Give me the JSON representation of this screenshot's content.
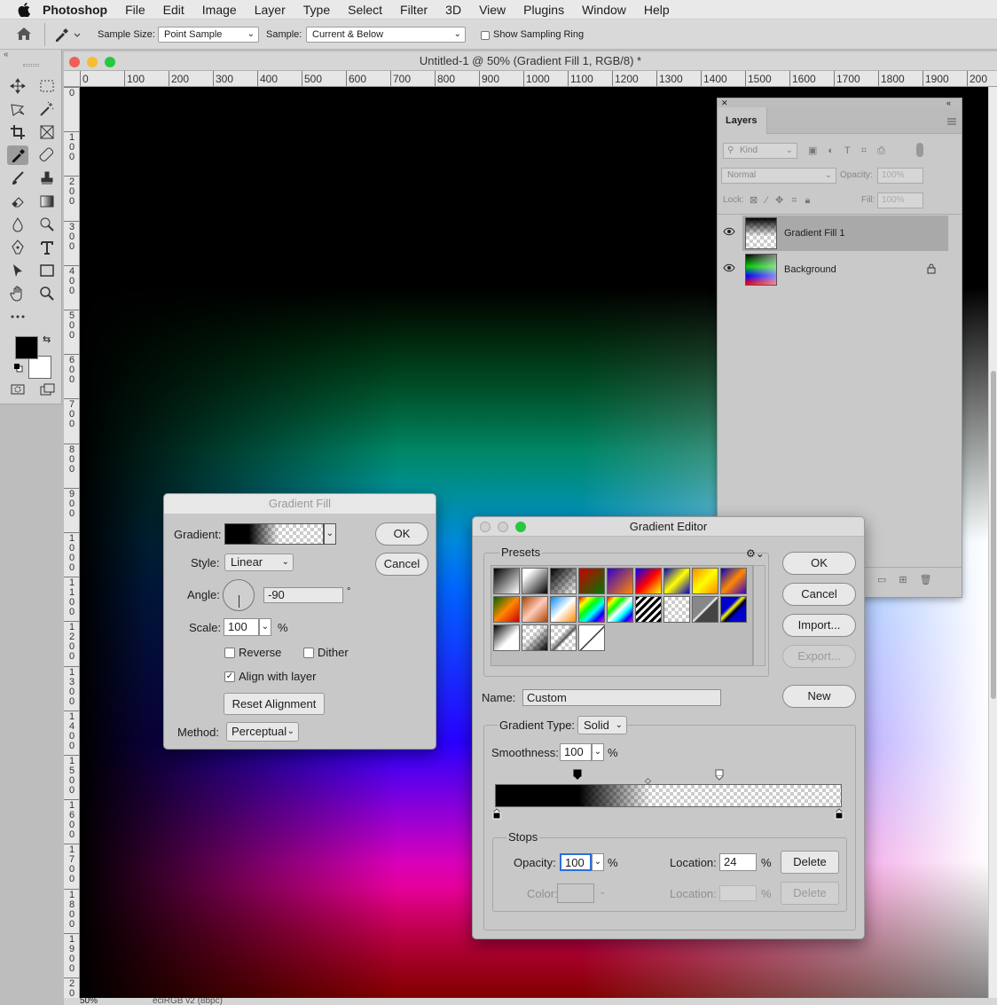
{
  "menubar": {
    "app": "Photoshop",
    "items": [
      "File",
      "Edit",
      "Image",
      "Layer",
      "Type",
      "Select",
      "Filter",
      "3D",
      "View",
      "Plugins",
      "Window",
      "Help"
    ]
  },
  "options_bar": {
    "sample_size_label": "Sample Size:",
    "sample_size_value": "Point Sample",
    "sample_label": "Sample:",
    "sample_value": "Current & Below",
    "show_ring_label": "Show Sampling Ring"
  },
  "document": {
    "title": "Untitled-1 @ 50% (Gradient Fill 1, RGB/8) *",
    "zoom": "50%",
    "profile": "eciRGB v2 (8bpc)"
  },
  "rulers": {
    "horizontal": [
      "0",
      "100",
      "200",
      "300",
      "400",
      "500",
      "600",
      "700",
      "800",
      "900",
      "1000",
      "1100",
      "1200",
      "1300",
      "1400",
      "1500",
      "1600",
      "1700",
      "1800",
      "1900",
      "200"
    ],
    "vertical": [
      "0",
      "1\n0\n0",
      "2\n0\n0",
      "3\n0\n0",
      "4\n0\n0",
      "5\n0\n0",
      "6\n0\n0",
      "7\n0\n0",
      "8\n0\n0",
      "9\n0\n0",
      "1\n0\n0\n0",
      "1\n1\n0\n0",
      "1\n2\n0\n0",
      "1\n3\n0\n0",
      "1\n4\n0\n0",
      "1\n5\n0\n0",
      "1\n6\n0\n0",
      "1\n7\n0\n0",
      "1\n8\n0\n0",
      "1\n9\n0\n0",
      "2\n0"
    ]
  },
  "layers_panel": {
    "title": "Layers",
    "kind_label": "Kind",
    "blend_mode": "Normal",
    "opacity_label": "Opacity:",
    "opacity_value": "100%",
    "lock_label": "Lock:",
    "fill_label": "Fill:",
    "fill_value": "100%",
    "layers": [
      {
        "name": "Gradient Fill 1",
        "selected": true
      },
      {
        "name": "Background",
        "selected": false
      }
    ]
  },
  "gradient_fill": {
    "title": "Gradient Fill",
    "gradient_label": "Gradient:",
    "style_label": "Style:",
    "style_value": "Linear",
    "angle_label": "Angle:",
    "angle_value": "-90",
    "degree": "°",
    "scale_label": "Scale:",
    "scale_value": "100",
    "percent": "%",
    "reverse_label": "Reverse",
    "dither_label": "Dither",
    "align_label": "Align with layer",
    "align_checked": true,
    "reset_label": "Reset Alignment",
    "method_label": "Method:",
    "method_value": "Perceptual",
    "ok": "OK",
    "cancel": "Cancel"
  },
  "gradient_editor": {
    "title": "Gradient Editor",
    "presets_label": "Presets",
    "name_label": "Name:",
    "name_value": "Custom",
    "type_label": "Gradient Type:",
    "type_value": "Solid",
    "smoothness_label": "Smoothness:",
    "smoothness_value": "100",
    "percent": "%",
    "stops_label": "Stops",
    "opacity_label": "Opacity:",
    "opacity_value": "100",
    "location_label": "Location:",
    "location_value": "24",
    "color_label": "Color:",
    "location2_label": "Location:",
    "delete_label": "Delete",
    "ok": "OK",
    "cancel": "Cancel",
    "import": "Import...",
    "export": "Export...",
    "new": "New"
  },
  "colors": {
    "accent": "#2a6fd6",
    "close": "#ee5f57",
    "minimize": "#f6bd2e",
    "zoom": "#27c840"
  }
}
